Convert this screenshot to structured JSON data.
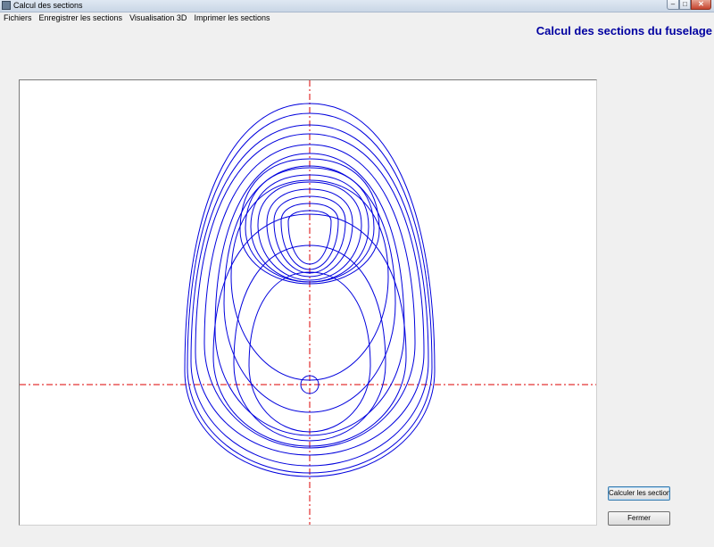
{
  "window": {
    "title": "Calcul des sections",
    "controls": {
      "minimize": "–",
      "maximize": "□",
      "close": "✕"
    },
    "icon": "app-icon"
  },
  "menu": {
    "items": [
      "Fichiers",
      "Enregistrer les sections",
      "Visualisation 3D",
      "Imprimer les sections"
    ]
  },
  "header": {
    "title": "Calcul des sections du fuselage"
  },
  "drawing": {
    "stroke_color": "#0000dd",
    "axis_color": "#dd0000",
    "sections": 19
  },
  "buttons": {
    "calculate_label": "Calculer les sections",
    "close_label": "Fermer"
  }
}
